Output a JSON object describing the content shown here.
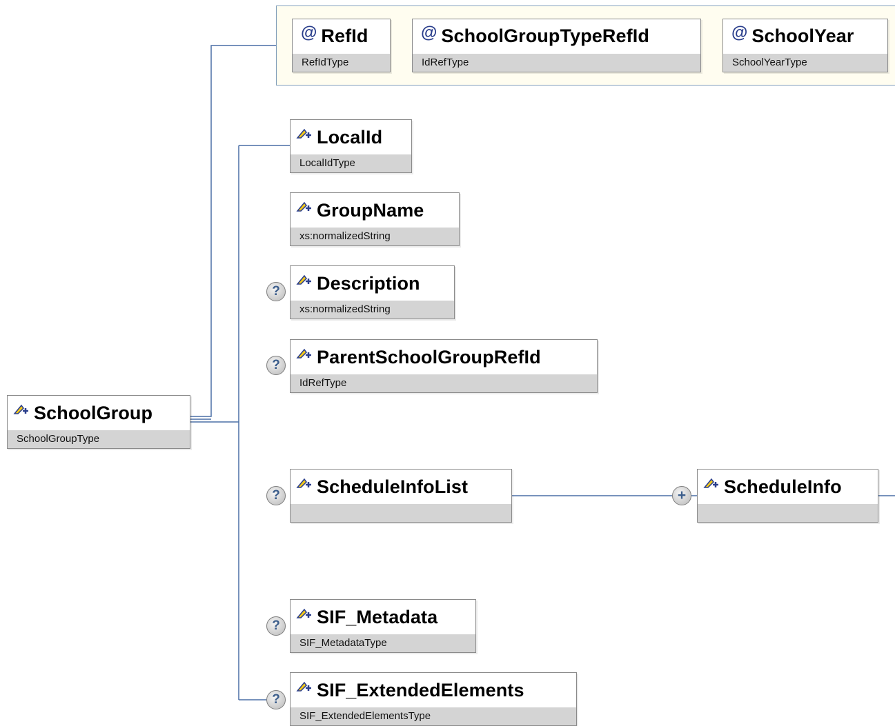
{
  "root": {
    "name": "SchoolGroup",
    "type": "SchoolGroupType",
    "icon": "element-icon"
  },
  "attributes": [
    {
      "name": "RefId",
      "type": "RefIdType",
      "icon": "attribute-at-icon"
    },
    {
      "name": "SchoolGroupTypeRefId",
      "type": "IdRefType",
      "icon": "attribute-at-icon"
    },
    {
      "name": "SchoolYear",
      "type": "SchoolYearType",
      "icon": "attribute-at-icon"
    }
  ],
  "elements": [
    {
      "name": "LocalId",
      "type": "LocalIdType",
      "optional": false
    },
    {
      "name": "GroupName",
      "type": "xs:normalizedString",
      "optional": false
    },
    {
      "name": "Description",
      "type": "xs:normalizedString",
      "optional": true
    },
    {
      "name": "ParentSchoolGroupRefId",
      "type": "IdRefType",
      "optional": true
    },
    {
      "name": "ScheduleInfoList",
      "type": "",
      "optional": true
    },
    {
      "name": "SIF_Metadata",
      "type": "SIF_MetadataType",
      "optional": true
    },
    {
      "name": "SIF_ExtendedElements",
      "type": "SIF_ExtendedElementsType",
      "optional": true
    }
  ],
  "child": {
    "name": "ScheduleInfo",
    "type": "",
    "multiplicity": "+"
  },
  "badges": {
    "optional": "?",
    "repeat": "+",
    "attribute": "@"
  },
  "colors": {
    "connector": "#4a6fa5",
    "panel_bg": "#fffdf0",
    "type_bar": "#d4d4d4",
    "icon_yellow": "#f2c81a",
    "icon_blue": "#2a3e8c"
  }
}
